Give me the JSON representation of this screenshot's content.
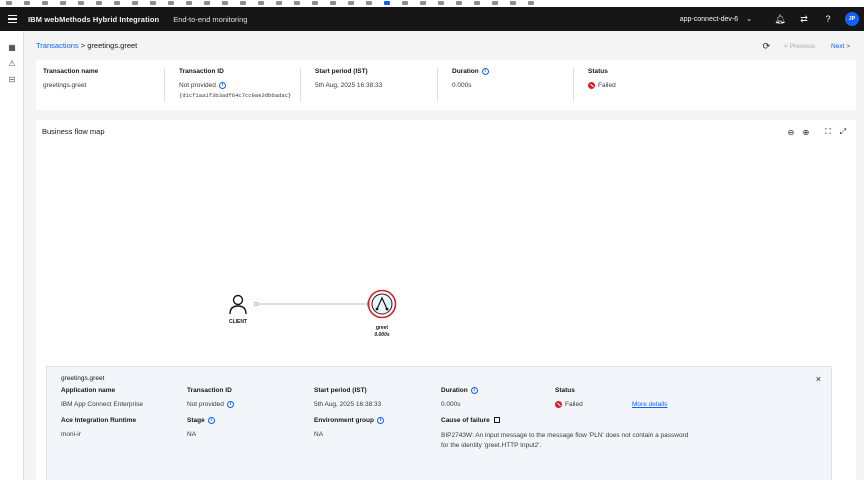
{
  "header": {
    "brand": "IBM webMethods Hybrid Integration",
    "section": "End-to-end monitoring",
    "environment": "app-connect-dev-6",
    "user_initials": "JP"
  },
  "breadcrumb": {
    "parent": "Transactions",
    "separator": ">",
    "current": "greetings.greet"
  },
  "nav": {
    "previous": "< Previous",
    "next": "Next >"
  },
  "summary": {
    "transaction_name_label": "Transaction name",
    "transaction_name": "greetings.greet",
    "transaction_id_label": "Transaction ID",
    "transaction_id": "Not provided",
    "transaction_hash": "{d1cf1aa1f3b3adf64c7cc9ae3db6adac}",
    "start_label": "Start period (IST)",
    "start": "5th Aug, 2025 16:38:33",
    "duration_label": "Duration",
    "duration": "0.000s",
    "status_label": "Status",
    "status": "Failed"
  },
  "map": {
    "title": "Business flow map",
    "client_label": "CLIENT",
    "node_name": "greet",
    "node_duration": "0.000s",
    "status_color": "#da1e28",
    "accent": "#0f62fe"
  },
  "detail": {
    "title": "greetings.greet",
    "app_name_label": "Application name",
    "app_name": "IBM App Connect Enterprise",
    "transaction_id_label": "Transaction ID",
    "transaction_id": "Not provided",
    "start_label": "Start period (IST)",
    "start": "5th Aug, 2025 16:38:33",
    "duration_label": "Duration",
    "duration": "0.000s",
    "status_label": "Status",
    "status": "Failed",
    "more_details": "More details",
    "runtime_label": "Ace Integration Runtime",
    "runtime": "moni-ir",
    "stage_label": "Stage",
    "stage": "NA",
    "env_group_label": "Environment group",
    "env_group": "NA",
    "cause_label": "Cause of failure",
    "cause": "BIP2743W: An input message to the message flow 'PLN' does not contain a password for the identity 'greet.HTTP Input2'."
  }
}
